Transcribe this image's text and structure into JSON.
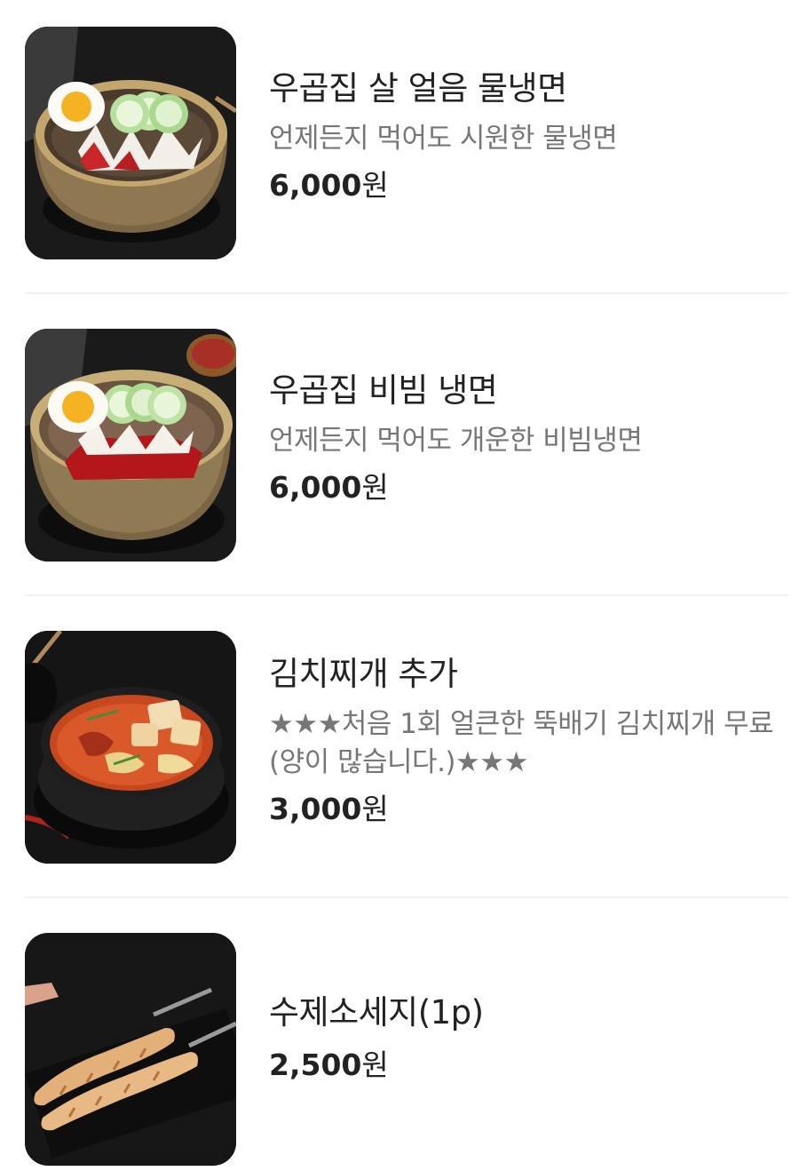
{
  "menu": {
    "items": [
      {
        "name": "우곱집 살 얼음 물냉면",
        "description": "언제든지 먹어도 시원한 물냉면",
        "price_number": "6,000",
        "price_unit": "원",
        "image_icon": "mul-naengmyeon-photo"
      },
      {
        "name": "우곱집 비빔 냉면",
        "description": "언제든지 먹어도 개운한 비빔냉면",
        "price_number": "6,000",
        "price_unit": "원",
        "image_icon": "bibim-naengmyeon-photo"
      },
      {
        "name": "김치찌개 추가",
        "description": "★★★처음 1회 얼큰한 뚝배기 김치찌개 무료(양이 많습니다.)★★★",
        "price_number": "3,000",
        "price_unit": "원",
        "image_icon": "kimchi-stew-photo"
      },
      {
        "name": "수제소세지(1p)",
        "description": "",
        "price_number": "2,500",
        "price_unit": "원",
        "image_icon": "sausage-photo"
      }
    ]
  },
  "colors": {
    "background": "#ffffff",
    "text_primary": "#222222",
    "text_secondary": "#777777",
    "divider": "#f1f1f1"
  }
}
